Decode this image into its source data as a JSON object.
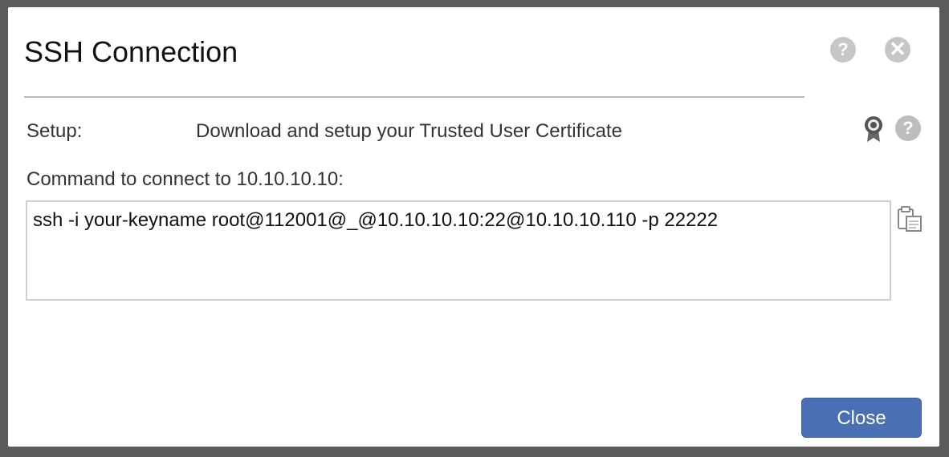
{
  "dialog": {
    "title": "SSH Connection",
    "help_icon": "?",
    "close_icon": "✕"
  },
  "setup": {
    "label": "Setup:",
    "link_text": "Download and setup your Trusted User Certificate",
    "help_icon": "?"
  },
  "command": {
    "label": "Command to connect to 10.10.10.10:",
    "value": "ssh -i your-keyname root@112001@_@10.10.10.10:22@10.10.10.110 -p 22222"
  },
  "footer": {
    "close_label": "Close"
  },
  "colors": {
    "overlay": "#5b5b5b",
    "primary_button": "#4a6fb5",
    "icon_gray": "#c6c6c6"
  },
  "icons": {
    "help": "help-icon",
    "close": "close-icon",
    "certificate": "certificate-icon",
    "copy": "copy-icon"
  }
}
